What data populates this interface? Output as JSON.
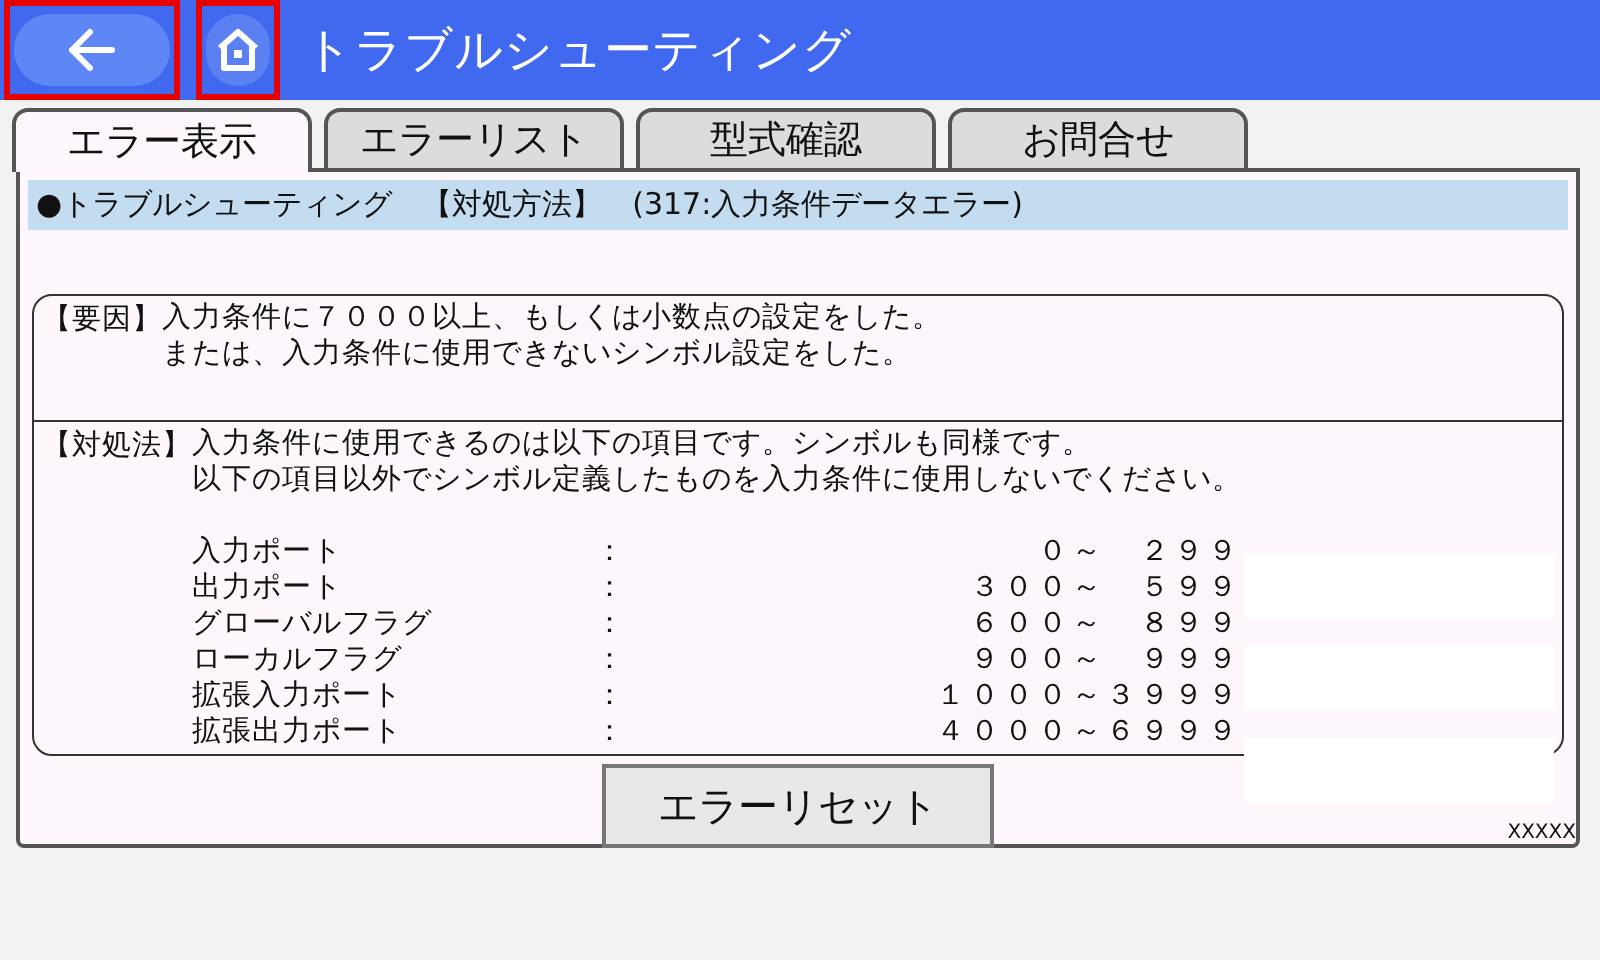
{
  "header": {
    "title": "トラブルシューティング",
    "back_button": {
      "highlighted": true
    },
    "home_button": {
      "highlighted": true
    }
  },
  "tabs": [
    {
      "label": "エラー表示",
      "selected": true
    },
    {
      "label": "エラーリスト",
      "selected": false
    },
    {
      "label": "型式確認",
      "selected": false
    },
    {
      "label": "お問合せ",
      "selected": false
    }
  ],
  "info_bar": "●トラブルシューティング　【対処方法】　(317:入力条件データエラー)",
  "cause": {
    "label": "【要因】",
    "lines": [
      "入力条件に７０００以上、もしくは小数点の設定をした。",
      "または、入力条件に使用できないシンボル設定をした。"
    ]
  },
  "remedy": {
    "label": "【対処法】",
    "lines": [
      "入力条件に使用できるのは以下の項目です。シンボルも同様です。",
      "以下の項目以外でシンボル定義したものを入力条件に使用しないでください。"
    ],
    "ranges": [
      {
        "name": "入力ポート",
        "sep": "：",
        "range": "０～　２９９"
      },
      {
        "name": "出力ポート",
        "sep": "：",
        "range": "３００～　５９９"
      },
      {
        "name": "グローバルフラグ",
        "sep": "：",
        "range": "６００～　８９９"
      },
      {
        "name": "ローカルフラグ",
        "sep": "：",
        "range": "９００～　９９９"
      },
      {
        "name": "拡張入力ポート",
        "sep": "：",
        "range": "１０００～３９９９"
      },
      {
        "name": "拡張出力ポート",
        "sep": "：",
        "range": "４０００～６９９９"
      }
    ]
  },
  "reset_button": "エラーリセット",
  "footer_code": "XXXXX"
}
